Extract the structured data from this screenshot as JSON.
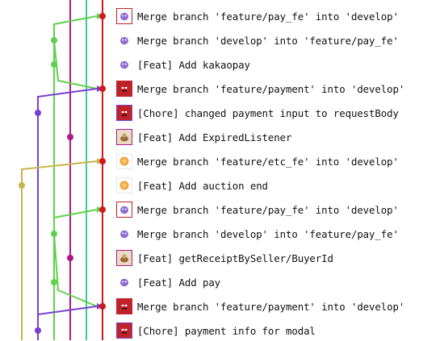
{
  "commits": [
    {
      "message": "Merge branch 'feature/pay_fe' into 'develop'",
      "avatar": "purple-creature-avatar",
      "avatar_color": "#8e6cd0",
      "row_of": "lane-red"
    },
    {
      "message": "Merge branch 'develop' into 'feature/pay_fe'",
      "avatar": "purple-creature-avatar",
      "avatar_color": "#8e6cd0",
      "row_of": "lane-green"
    },
    {
      "message": "[Feat] Add kakaopay",
      "avatar": "purple-creature-avatar",
      "avatar_color": "#8e6cd0",
      "row_of": "lane-green"
    },
    {
      "message": "Merge branch 'feature/payment' into 'develop'",
      "avatar": "red-hero-avatar",
      "avatar_color": "#c0222a",
      "row_of": "lane-red"
    },
    {
      "message": "[Chore] changed payment input to requestBody",
      "avatar": "red-hero-avatar",
      "avatar_color": "#c0222a",
      "row_of": "lane-purple"
    },
    {
      "message": "[Feat] Add ExpiredListener",
      "avatar": "brown-character-avatar",
      "avatar_color": "#9a6a3a",
      "row_of": "lane-magenta"
    },
    {
      "message": "Merge branch 'feature/etc_fe' into 'develop'",
      "avatar": "orange-circle-avatar",
      "avatar_color": "#f2a23c",
      "row_of": "lane-red"
    },
    {
      "message": "[Feat] Add auction end",
      "avatar": "orange-circle-avatar",
      "avatar_color": "#f2a23c",
      "row_of": "lane-olive"
    },
    {
      "message": "Merge branch 'feature/pay_fe' into 'develop'",
      "avatar": "purple-creature-avatar",
      "avatar_color": "#8e6cd0",
      "row_of": "lane-red"
    },
    {
      "message": "Merge branch 'develop' into 'feature/pay_fe'",
      "avatar": "purple-creature-avatar",
      "avatar_color": "#8e6cd0",
      "row_of": "lane-green"
    },
    {
      "message": "[Feat] getReceiptBySeller/BuyerId",
      "avatar": "brown-character-avatar",
      "avatar_color": "#9a6a3a",
      "row_of": "lane-magenta"
    },
    {
      "message": "[Feat] Add pay",
      "avatar": "purple-creature-avatar",
      "avatar_color": "#8e6cd0",
      "row_of": "lane-green"
    },
    {
      "message": "Merge branch 'feature/payment' into 'develop'",
      "avatar": "red-hero-avatar",
      "avatar_color": "#c0222a",
      "row_of": "lane-red"
    },
    {
      "message": "[Chore] payment info for modal",
      "avatar": "red-hero-avatar",
      "avatar_color": "#c0222a",
      "row_of": "lane-purple"
    }
  ],
  "lanes": {
    "olive": "#c8b44a",
    "purple": "#7a3fd0",
    "green": "#5fd14a",
    "magenta": "#b0168a",
    "teal": "#3cc8a0",
    "red": "#d0191d"
  }
}
